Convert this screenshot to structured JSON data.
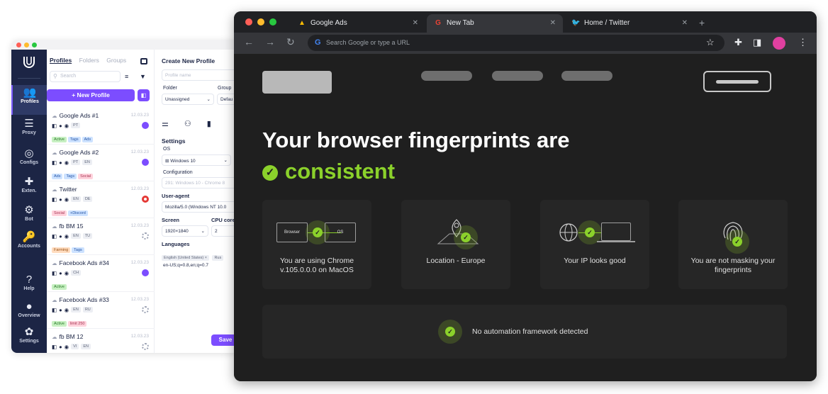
{
  "app": {
    "rail": [
      {
        "label": "Profiles",
        "icon": "profiles-icon"
      },
      {
        "label": "Proxy",
        "icon": "proxy-icon"
      },
      {
        "label": "Configs",
        "icon": "configs-icon"
      },
      {
        "label": "Exten.",
        "icon": "extensions-icon"
      },
      {
        "label": "Bot",
        "icon": "bot-icon"
      },
      {
        "label": "Accounts",
        "icon": "accounts-icon"
      },
      {
        "label": "Help",
        "icon": "help-icon"
      },
      {
        "label": "Overview",
        "icon": "overview-icon"
      },
      {
        "label": "Settings",
        "icon": "settings-icon"
      }
    ],
    "tabs": [
      "Profiles",
      "Folders",
      "Groups"
    ],
    "search_placeholder": "Search",
    "new_profile_label": "+ New Profile",
    "profiles": [
      {
        "name": "Google Ads #1",
        "date": "12.03.23",
        "chips": [
          "PT"
        ],
        "tags": [
          {
            "t": "Active",
            "c": "green"
          },
          {
            "t": "Tags",
            "c": "blue"
          },
          {
            "t": "Ads",
            "c": "blue"
          }
        ],
        "action": "play"
      },
      {
        "name": "Google Ads #2",
        "date": "12.03.23",
        "chips": [
          "PT",
          "EN"
        ],
        "tags": [
          {
            "t": "Ads",
            "c": "blue"
          },
          {
            "t": "Tags",
            "c": "blue"
          },
          {
            "t": "Social",
            "c": "pink"
          }
        ],
        "action": "play"
      },
      {
        "name": "Twitter",
        "date": "12.03.23",
        "chips": [
          "EN",
          "DE"
        ],
        "tags": [
          {
            "t": "Social",
            "c": "pink"
          },
          {
            "t": "+Discord",
            "c": "blue"
          }
        ],
        "action": "stop"
      },
      {
        "name": "fb BM 15",
        "date": "12.03.23",
        "chips": [
          "EN",
          "TU"
        ],
        "tags": [
          {
            "t": "Farming",
            "c": "orange"
          },
          {
            "t": "Tags",
            "c": "blue"
          }
        ],
        "action": "load"
      },
      {
        "name": "Facebook Ads #34",
        "date": "12.03.23",
        "chips": [
          "CH"
        ],
        "tags": [
          {
            "t": "Active",
            "c": "green"
          }
        ],
        "action": "play"
      },
      {
        "name": "Facebook Ads #33",
        "date": "12.03.23",
        "chips": [
          "EN",
          "RU"
        ],
        "tags": [
          {
            "t": "Active",
            "c": "green"
          },
          {
            "t": "limit 250",
            "c": "pink"
          }
        ],
        "action": "load"
      },
      {
        "name": "fb BM 12",
        "date": "12.03.23",
        "chips": [
          "VI",
          "EN"
        ],
        "tags": [],
        "action": "load"
      }
    ],
    "create": {
      "title": "Create New Profile",
      "name_placeholder": "Profile name",
      "folder_label": "Folder",
      "folder_value": "Unassigned",
      "group_label": "Group",
      "group_value": "Defau",
      "settings_label": "Settings",
      "os_label": "OS",
      "os_value": "Windows 10",
      "config_label": "Configuration",
      "config_value": "291: Windows 10 - Chrome 8",
      "ua_label": "User-agent",
      "ua_value": "Mozilla/5.0 (Windows NT 10.0",
      "screen_label": "Screen",
      "screen_value": "1920×1840",
      "cpu_label": "CPU core",
      "cpu_value": "2",
      "lang_label": "Languages",
      "lang_chip": "English (United States) ×",
      "lang_chip2": "Rus",
      "lang_value": "en-US;q=0.8,en;q=0.7",
      "save_label": "Save"
    }
  },
  "browser": {
    "tabs": [
      {
        "title": "Google Ads",
        "favicon": "google-ads-icon"
      },
      {
        "title": "New Tab",
        "favicon": "google-icon"
      },
      {
        "title": "Home / Twitter",
        "favicon": "twitter-icon"
      }
    ],
    "omnibox_placeholder": "Search Google or type a URL",
    "headline": "Your browser fingerprints are",
    "status": "consistent",
    "cards": [
      {
        "text": "You are using Chrome v.105.0.0.0 on MacOS",
        "vis_left": "Browser",
        "vis_right": "OS"
      },
      {
        "text": "Location - Europe"
      },
      {
        "text": "Your IP looks good"
      },
      {
        "text": "You are not masking your fingerprints"
      }
    ],
    "automation": "No automation framework detected",
    "colors": {
      "accent": "#8bd12b",
      "background": "#1f1f1f",
      "card": "#262626",
      "primary": "#7c4dff"
    }
  }
}
